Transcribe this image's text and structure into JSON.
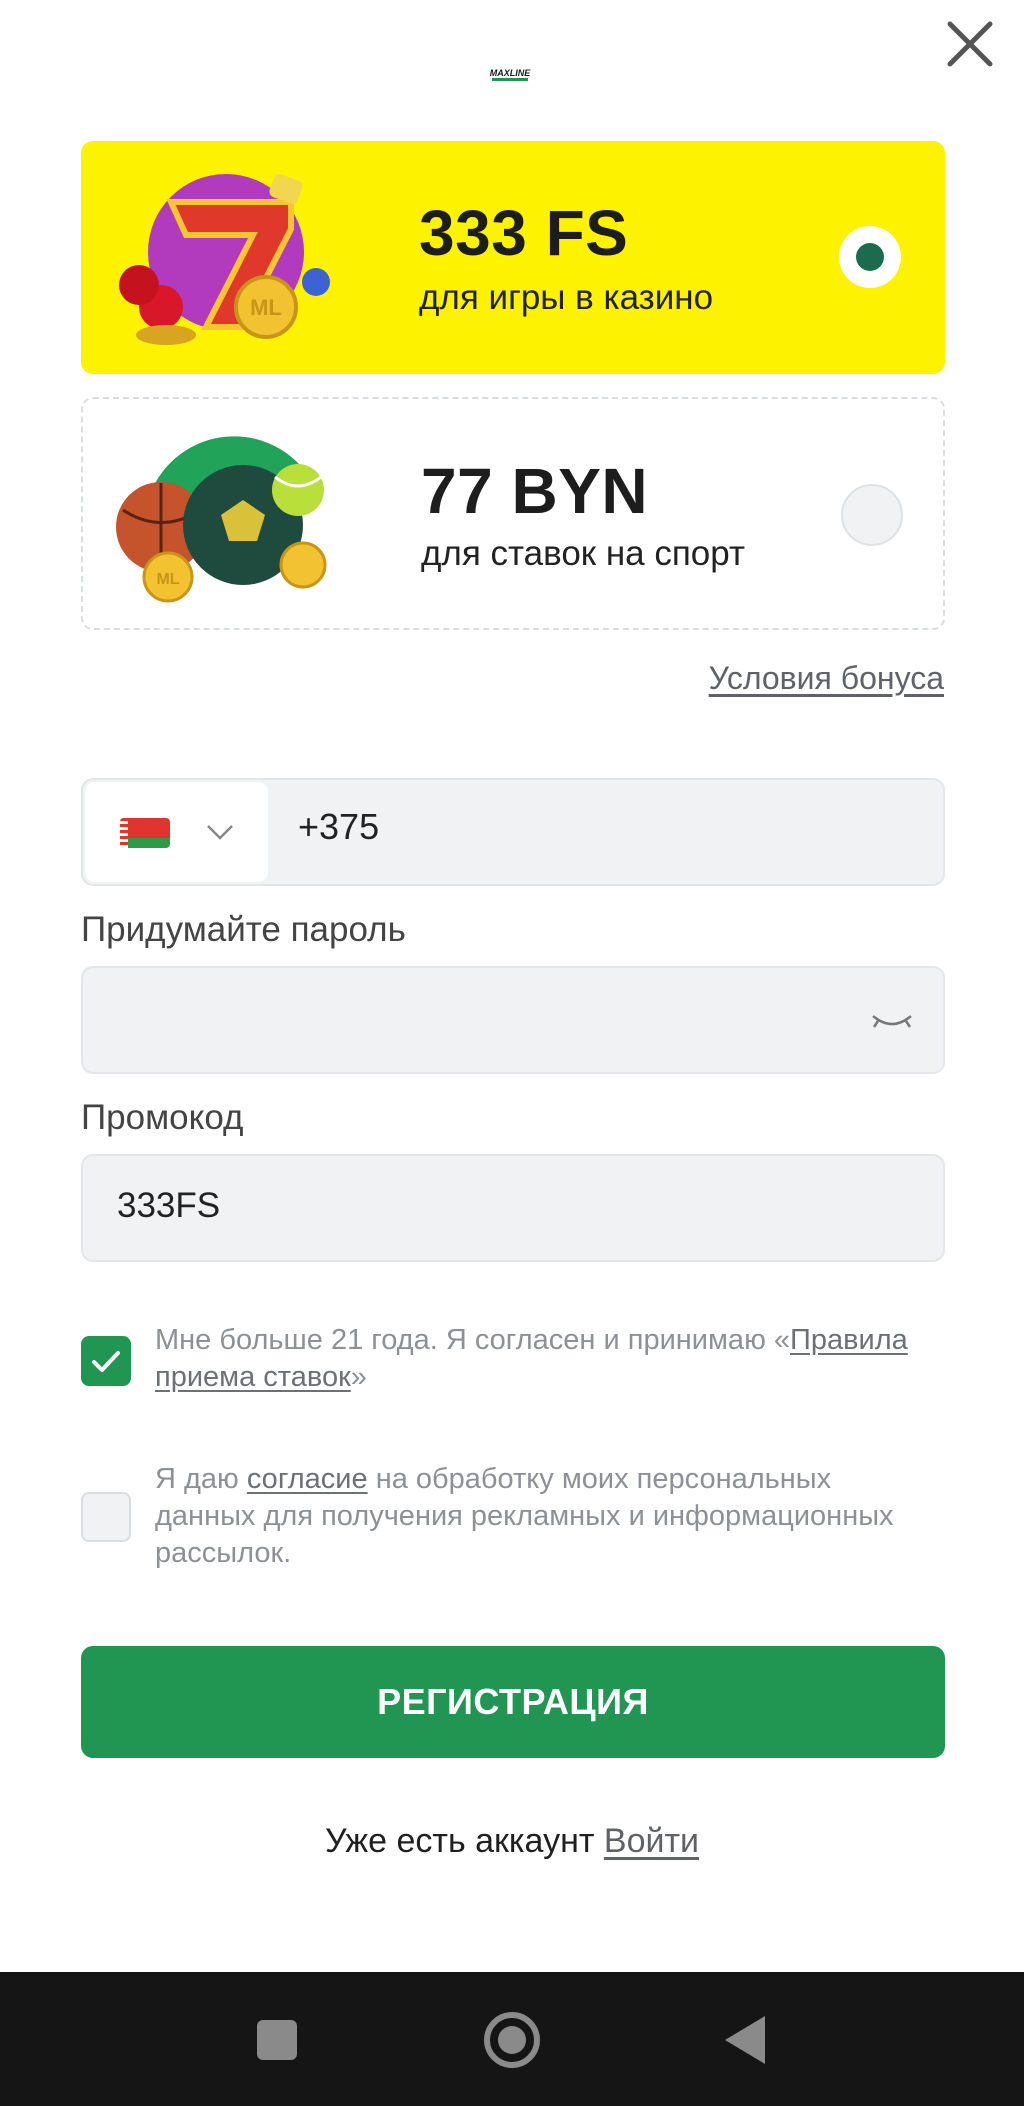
{
  "header": {
    "logo_text": "MAXLINE",
    "close_icon": "close-icon"
  },
  "bonuses": [
    {
      "amount": "333 FS",
      "subtitle": "для игры в казино",
      "selected": true,
      "color": "#fdf200"
    },
    {
      "amount": "77 BYN",
      "subtitle": "для ставок на спорт",
      "selected": false
    }
  ],
  "bonus_terms_link": "Условия бонуса",
  "form": {
    "phone": {
      "country_flag": "belarus-flag-icon",
      "value": "+375"
    },
    "password": {
      "label": "Придумайте пароль",
      "value": "",
      "icon": "eye-closed-icon"
    },
    "promo": {
      "label": "Промокод",
      "value": "333FS"
    }
  },
  "agreements": {
    "age": {
      "checked": true,
      "text_before": "Мне больше 21 года. Я согласен и принимаю «",
      "link": "Правила приема ставок",
      "text_after": "»"
    },
    "marketing": {
      "checked": false,
      "text_before": "Я даю ",
      "link": "согласие",
      "text_after": " на обработку моих персональных данных для получения рекламных и информационных рассылок."
    }
  },
  "register_button": "РЕГИСТРАЦИЯ",
  "login": {
    "prompt": "Уже есть аккаунт",
    "link": "Войти"
  },
  "nav": [
    "recents-square-icon",
    "home-circle-icon",
    "back-triangle-icon"
  ],
  "colors": {
    "accent_green": "#219653",
    "yellow": "#fdf200",
    "dark_green": "#1d6b4f"
  }
}
